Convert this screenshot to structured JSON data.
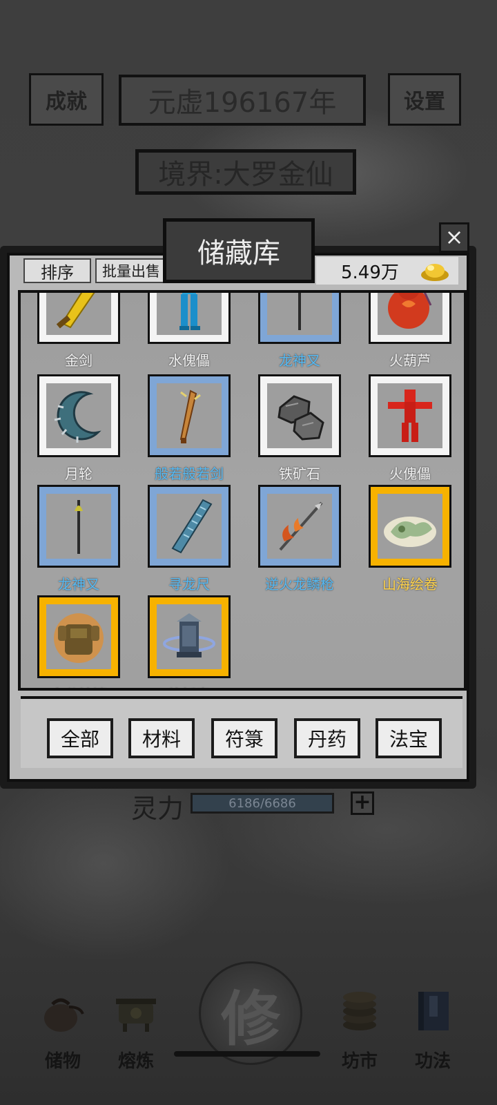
{
  "background": {
    "achievement_label": "成就",
    "settings_label": "设置",
    "year": "元虚196167年",
    "realm": "境界:大罗金仙",
    "spirit_label": "灵力",
    "spirit_value": "6186/6686",
    "spirit_plus": "+"
  },
  "dialog": {
    "title": "储藏库",
    "close": "×",
    "sort_label": "排序",
    "bulk_sell_label": "批量出售",
    "coins": "5.49万",
    "coin_icon": "gold-ingot-icon"
  },
  "items": [
    {
      "name": "金剑",
      "rarity": "white",
      "icon": "gold-sword-icon"
    },
    {
      "name": "水傀儡",
      "rarity": "white",
      "icon": "water-puppet-icon"
    },
    {
      "name": "龙神叉",
      "rarity": "blue",
      "icon": "dragon-trident-icon"
    },
    {
      "name": "火葫芦",
      "rarity": "white",
      "icon": "fire-gourd-icon"
    },
    {
      "name": "月轮",
      "rarity": "white",
      "icon": "moon-wheel-icon"
    },
    {
      "name": "般若般若剑",
      "rarity": "blue",
      "icon": "prajna-sword-icon"
    },
    {
      "name": "铁矿石",
      "rarity": "white",
      "icon": "iron-ore-icon"
    },
    {
      "name": "火傀儡",
      "rarity": "white",
      "icon": "fire-puppet-icon"
    },
    {
      "name": "龙神叉",
      "rarity": "blue",
      "icon": "dragon-trident-icon"
    },
    {
      "name": "寻龙尺",
      "rarity": "blue",
      "icon": "dragon-ruler-icon"
    },
    {
      "name": "逆火龙鳞枪",
      "rarity": "blue",
      "icon": "dragon-spear-icon"
    },
    {
      "name": "山海绘卷",
      "rarity": "gold",
      "icon": "scroll-icon"
    },
    {
      "name": "夸父神铠",
      "rarity": "gold",
      "icon": "armor-icon"
    },
    {
      "name": "炼妖壶",
      "rarity": "gold",
      "icon": "demon-pot-icon"
    }
  ],
  "categories": [
    "全部",
    "材料",
    "符箓",
    "丹药",
    "法宝"
  ],
  "nav": {
    "storage": "储物",
    "smelt": "熔炼",
    "cultivate": "修",
    "market": "坊市",
    "skills": "功法"
  },
  "colors": {
    "rarity_white": "#f4f4f4",
    "rarity_blue": "#7fa6d6",
    "rarity_gold": "#f7b200",
    "name_blue": "#56b9f2",
    "name_gold": "#ffd34a"
  }
}
